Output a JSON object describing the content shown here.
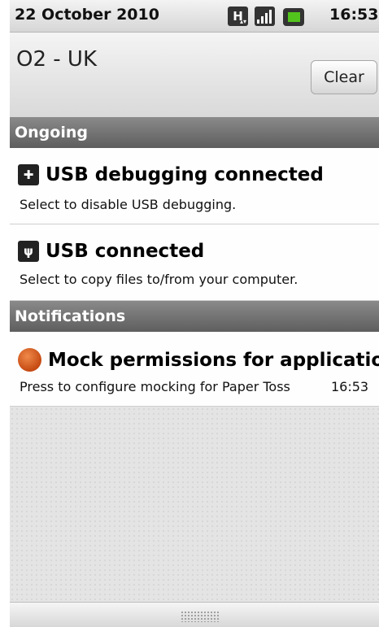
{
  "status_bar": {
    "date": "22 October 2010",
    "time": "16:53",
    "network_badge": "H",
    "icons": [
      "hsdpa-icon",
      "signal-icon",
      "battery-charging-icon"
    ]
  },
  "header": {
    "carrier": "O2 - UK",
    "clear_label": "Clear"
  },
  "sections": {
    "ongoing": "Ongoing",
    "notifications": "Notifications"
  },
  "ongoing_items": [
    {
      "icon": "android-debug-icon",
      "title": "USB debugging connected",
      "subtitle": "Select to disable USB debugging."
    },
    {
      "icon": "usb-icon",
      "title": "USB connected",
      "subtitle": "Select to copy files to/from your computer."
    }
  ],
  "notification_items": [
    {
      "icon": "mock-permissions-icon",
      "title": "Mock permissions for application",
      "subtitle": "Press to configure mocking for Paper Toss",
      "time": "16:53"
    }
  ],
  "colors": {
    "section_header": "#6e6e6e",
    "battery_charging": "#52c31c",
    "mock_icon": "#d2591c"
  }
}
